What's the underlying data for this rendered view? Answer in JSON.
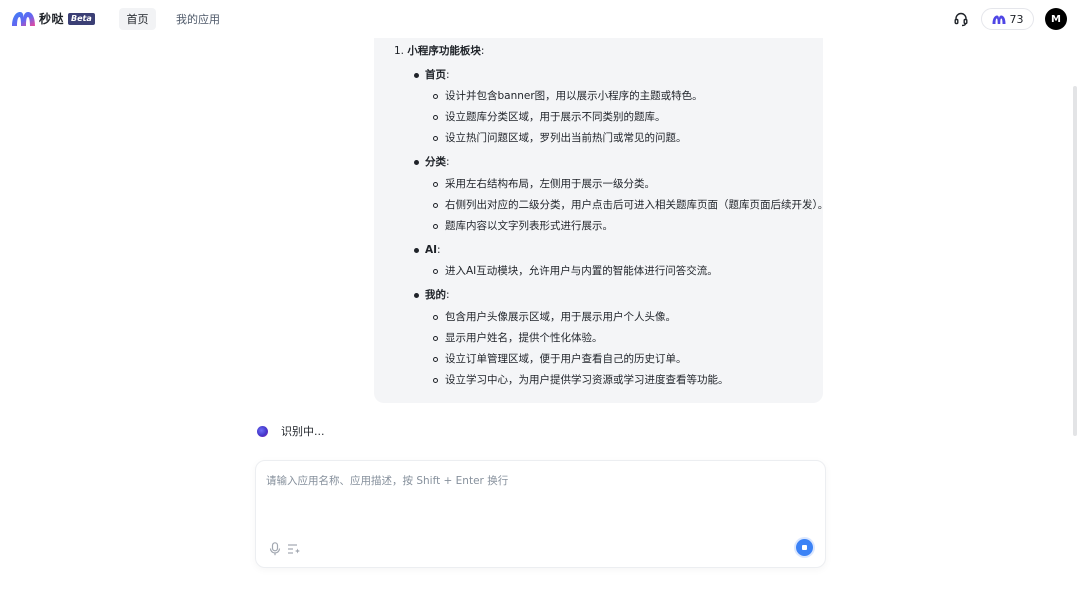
{
  "header": {
    "brand": "秒哒",
    "beta": "Beta",
    "nav": [
      {
        "label": "首页",
        "active": true
      },
      {
        "label": "我的应用",
        "active": false
      }
    ],
    "credits": "73",
    "avatar_initial": "M"
  },
  "message": {
    "section_number": "1.",
    "section_title": "小程序功能板块",
    "groups": [
      {
        "title": "首页",
        "items": [
          "设计并包含banner图，用以展示小程序的主题或特色。",
          "设立题库分类区域，用于展示不同类别的题库。",
          "设立热门问题区域，罗列出当前热门或常见的问题。"
        ]
      },
      {
        "title": "分类",
        "items": [
          "采用左右结构布局，左侧用于展示一级分类。",
          "右侧列出对应的二级分类，用户点击后可进入相关题库页面（题库页面后续开发）。",
          "题库内容以文字列表形式进行展示。"
        ]
      },
      {
        "title": "AI",
        "items": [
          "进入AI互动模块，允许用户与内置的智能体进行问答交流。"
        ]
      },
      {
        "title": "我的",
        "items": [
          "包含用户头像展示区域，用于展示用户个人头像。",
          "显示用户姓名，提供个性化体验。",
          "设立订单管理区域，便于用户查看自己的历史订单。",
          "设立学习中心，为用户提供学习资源或学习进度查看等功能。"
        ]
      }
    ]
  },
  "status": {
    "text": "识别中..."
  },
  "composer": {
    "placeholder": "请输入应用名称、应用描述，按 Shift + Enter 换行",
    "value": ""
  },
  "colors": {
    "accent": "#3b82f6",
    "bubble_bg": "#f4f5f7",
    "beta_bg": "#3b3f75"
  }
}
